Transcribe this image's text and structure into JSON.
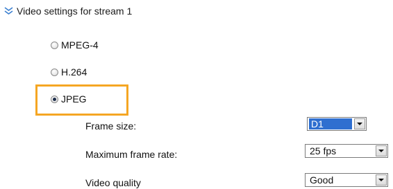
{
  "section": {
    "title": "Video settings for stream 1",
    "icon": "double-chevron-down-icon"
  },
  "codecs": [
    {
      "label": "MPEG-4",
      "checked": false
    },
    {
      "label": "H.264",
      "checked": false
    },
    {
      "label": "JPEG",
      "checked": true
    }
  ],
  "settings": {
    "frame_size": {
      "label": "Frame size:",
      "value": "D1"
    },
    "max_frame_rate": {
      "label": "Maximum frame rate:",
      "value": "25 fps"
    },
    "video_quality": {
      "label": "Video quality",
      "value": "Good"
    }
  },
  "colors": {
    "highlight": "#f5a623",
    "selection": "#2f6fd0"
  }
}
